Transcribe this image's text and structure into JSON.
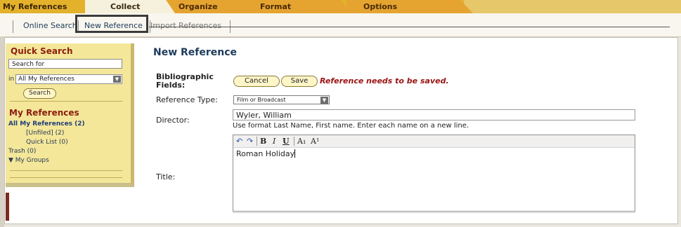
{
  "tabs": {
    "my_references": "My References",
    "collect": "Collect",
    "organize": "Organize",
    "format": "Format",
    "options": "Options"
  },
  "subnav": {
    "online_search": "Online Search",
    "new_reference": "New Reference",
    "import_references": "Import References"
  },
  "sidebar": {
    "quick_search_title": "Quick Search",
    "search_value": "Search for",
    "in_label": "in",
    "scope_selected": "All My References",
    "search_button": "Search",
    "my_refs_title": "My References",
    "items": [
      {
        "label": "All My References (2)"
      },
      {
        "label": "[Unfiled] (2)"
      },
      {
        "label": "Quick List (0)"
      },
      {
        "label": "Trash (0)"
      },
      {
        "label": "▼ My Groups"
      }
    ]
  },
  "main": {
    "heading": "New Reference",
    "bib_label_1": "Bibliographic",
    "bib_label_2": "Fields:",
    "cancel": "Cancel",
    "save": "Save",
    "warning": "Reference needs to be saved.",
    "ref_type_label": "Reference Type:",
    "ref_type_value": "Film or Broadcast",
    "director_label": "Director:",
    "director_value": "Wyler, William",
    "director_hint": "Use format Last Name, First name. Enter each name on a new line.",
    "title_label": "Title:",
    "title_value": "Roman Holiday",
    "toolbar": {
      "undo": "↶",
      "redo": "↷",
      "bold": "B",
      "italic": "I",
      "underline": "U",
      "subscript": "A₁",
      "superscript": "A¹"
    }
  },
  "colors": {
    "tab_gold": "#e3b12a",
    "sidebar_yellow": "#f4e79a",
    "heading_navy": "#1d3b5c",
    "warning_red": "#9a1212",
    "sidebar_title_red": "#8c1d0e"
  }
}
